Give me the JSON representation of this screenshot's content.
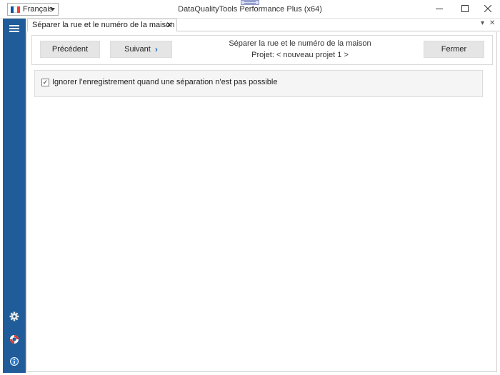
{
  "window": {
    "title": "DataQualityTools Performance Plus (x64)",
    "language": "Français",
    "flag_colors": [
      "#0055a4",
      "#ffffff",
      "#ef4135"
    ]
  },
  "sidebar": {
    "color": "#1f5c99",
    "icons": [
      "menu-icon",
      "gear-icon",
      "lifebuoy-icon",
      "info-icon"
    ]
  },
  "tab": {
    "label": "Séparer la rue et le numéro de la maison"
  },
  "nav": {
    "prev_label": "Précédent",
    "next_label": "Suivant",
    "close_label": "Fermer",
    "heading_line1": "Séparer la rue et le numéro de la maison",
    "heading_line2": "Projet: < nouveau projet 1 >"
  },
  "options": {
    "ignore_label": "Ignorer l'enregistrement quand une séparation n'est pas possible",
    "ignore_checked": true
  }
}
